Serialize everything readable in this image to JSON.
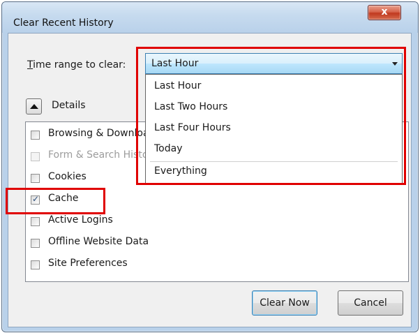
{
  "window": {
    "title": "Clear Recent History",
    "close_label": "x"
  },
  "time_range": {
    "label_prefix": "T",
    "label_rest": "ime range to clear:",
    "selected": "Last Hour",
    "options": [
      "Last Hour",
      "Last Two Hours",
      "Last Four Hours",
      "Today",
      "Everything"
    ]
  },
  "details": {
    "label": "Details"
  },
  "items": [
    {
      "label": "Browsing & Download History",
      "checked": false,
      "enabled": true
    },
    {
      "label": "Form & Search History",
      "checked": false,
      "enabled": false
    },
    {
      "label": "Cookies",
      "checked": false,
      "enabled": true
    },
    {
      "label": "Cache",
      "checked": true,
      "enabled": true
    },
    {
      "label": "Active Logins",
      "checked": false,
      "enabled": true
    },
    {
      "label": "Offline Website Data",
      "checked": false,
      "enabled": true
    },
    {
      "label": "Site Preferences",
      "checked": false,
      "enabled": true
    }
  ],
  "buttons": {
    "clear_now": "Clear Now",
    "cancel": "Cancel"
  },
  "colors": {
    "highlight": "#e00000",
    "frame": "#b9d1ea",
    "close_button": "#c0391f"
  }
}
